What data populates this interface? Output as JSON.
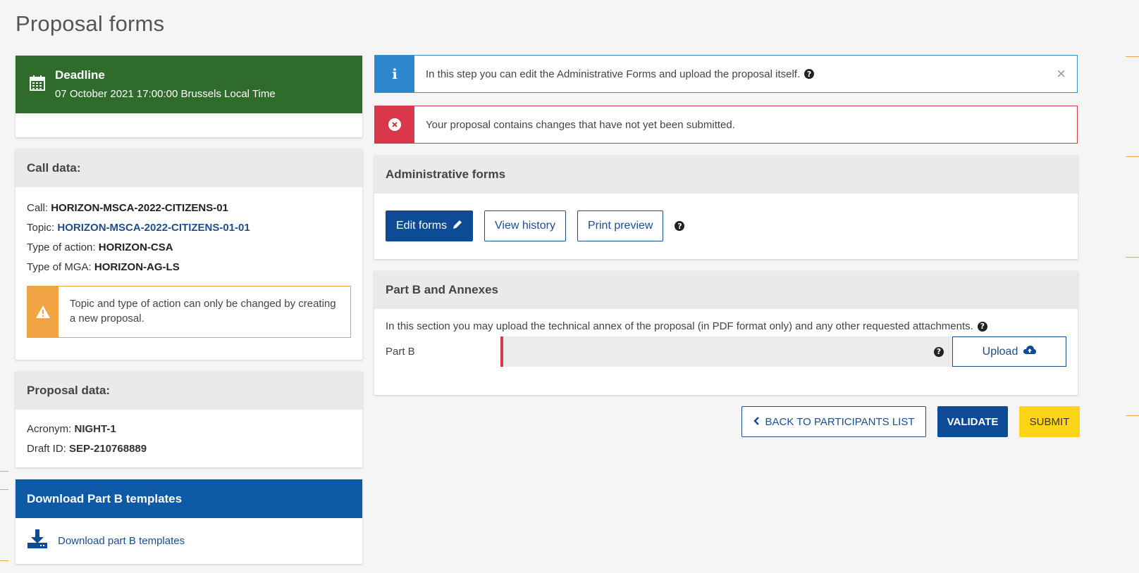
{
  "page": {
    "title": "Proposal forms"
  },
  "deadline": {
    "title": "Deadline",
    "date": "07 October 2021 17:00:00 Brussels Local Time",
    "icon": "calendar-icon"
  },
  "call_data": {
    "header": "Call data:",
    "call_label": "Call: ",
    "call_value": "HORIZON-MSCA-2022-CITIZENS-01",
    "topic_label": "Topic: ",
    "topic_value": "HORIZON-MSCA-2022-CITIZENS-01-01",
    "action_label": "Type of action: ",
    "action_value": "HORIZON-CSA",
    "mga_label": "Type of MGA: ",
    "mga_value": "HORIZON-AG-LS",
    "warning": "Topic and type of action can only be changed by creating a new proposal."
  },
  "proposal_data": {
    "header": "Proposal data:",
    "acronym_label": "Acronym: ",
    "acronym_value": "NIGHT-1",
    "draft_label": "Draft ID: ",
    "draft_value": "SEP-210768889"
  },
  "download": {
    "header": "Download Part B templates",
    "link": "Download part B templates"
  },
  "alerts": {
    "info": "In this step you can edit the Administrative Forms and upload the proposal itself.",
    "close": "×",
    "danger": "Your proposal contains changes that have not yet been submitted."
  },
  "admin_forms": {
    "header": "Administrative forms",
    "edit_label": "Edit forms",
    "history_label": "View history",
    "print_label": "Print preview"
  },
  "part_b": {
    "header": "Part B and Annexes",
    "description": "In this section you may upload the technical annex of the proposal (in PDF format only) and any other requested attachments.",
    "label": "Part B",
    "upload_label": "Upload"
  },
  "actions": {
    "back_label": "BACK TO PARTICIPANTS LIST",
    "validate_label": "VALIDATE",
    "submit_label": "SUBMIT"
  },
  "colors": {
    "deadline_green": "#2f6b2a",
    "primary_blue": "#0e4b95",
    "info_blue": "#2d87cd",
    "danger_red": "#d9384a",
    "warning_orange": "#f0a443",
    "submit_yellow": "#ffd617"
  }
}
